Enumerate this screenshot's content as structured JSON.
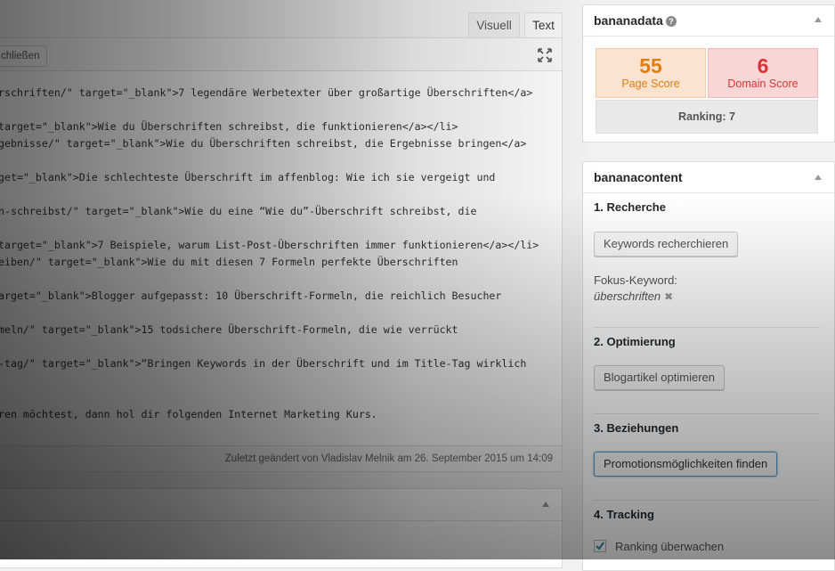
{
  "editor": {
    "tabs": {
      "visual": "Visuell",
      "text": "Text"
    },
    "close_button": "chließen",
    "code_lines": [
      "rschriften/\" target=\"_blank\">7 legendäre Werbetexter über großartige Überschriften</a>",
      "target=\"_blank\">Wie du Überschriften schreibst, die funktionieren</a></li>",
      "gebnisse/\" target=\"_blank\">Wie du Überschriften schreibst, die Ergebnisse bringen</a>",
      "get=\"_blank\">Die schlechteste Überschrift im affenblog: Wie ich sie vergeigt und",
      "n-schreibst/\" target=\"_blank\">Wie du eine “Wie du”-Überschrift schreibst, die",
      "target=\"_blank\">7 Beispiele, warum List-Post-Überschriften immer funktionieren</a></li>",
      "eiben/\" target=\"_blank\">Wie du mit diesen 7 Formeln perfekte Überschriften",
      "arget=\"_blank\">Blogger aufgepasst: 10 Überschrift-Formeln, die reichlich Besucher",
      "meln/\" target=\"_blank\">15 todsichere Überschrift-Formeln, die wie verrückt",
      "-tag/\" target=\"_blank\">“Bringen Keywords in der Überschrift und im Title-Tag wirklich",
      "ren möchtest, dann hol dir folgenden Internet Marketing Kurs."
    ],
    "status": "Zuletzt geändert von Vladislav Melnik am 26. September 2015 um 14:09"
  },
  "bananadata": {
    "title": "bananadata",
    "help_icon": "?",
    "page_score": {
      "value": "55",
      "label": "Page Score"
    },
    "domain_score": {
      "value": "6",
      "label": "Domain Score"
    },
    "ranking": "Ranking: 7"
  },
  "bananacontent": {
    "title": "bananacontent",
    "section1": {
      "title": "1. Recherche",
      "button": "Keywords recherchieren"
    },
    "focus_label": "Fokus-Keyword:",
    "focus_value": "überschriften",
    "remove_glyph": "✖",
    "section2": {
      "title": "2. Optimierung",
      "button": "Blogartikel optimieren"
    },
    "section3": {
      "title": "3. Beziehungen",
      "button": "Promotionsmöglichkeiten finden"
    },
    "section4": {
      "title": "4. Tracking",
      "checkbox_label": "Ranking überwachen",
      "checked": true
    }
  },
  "icons": {
    "fullscreen": "fullscreen-icon",
    "collapse": "arrow-up-icon",
    "check": "checkmark-icon"
  },
  "colors": {
    "page_score": "#e07c14",
    "domain_score": "#d83434",
    "focus_border": "#5b9dd9"
  }
}
